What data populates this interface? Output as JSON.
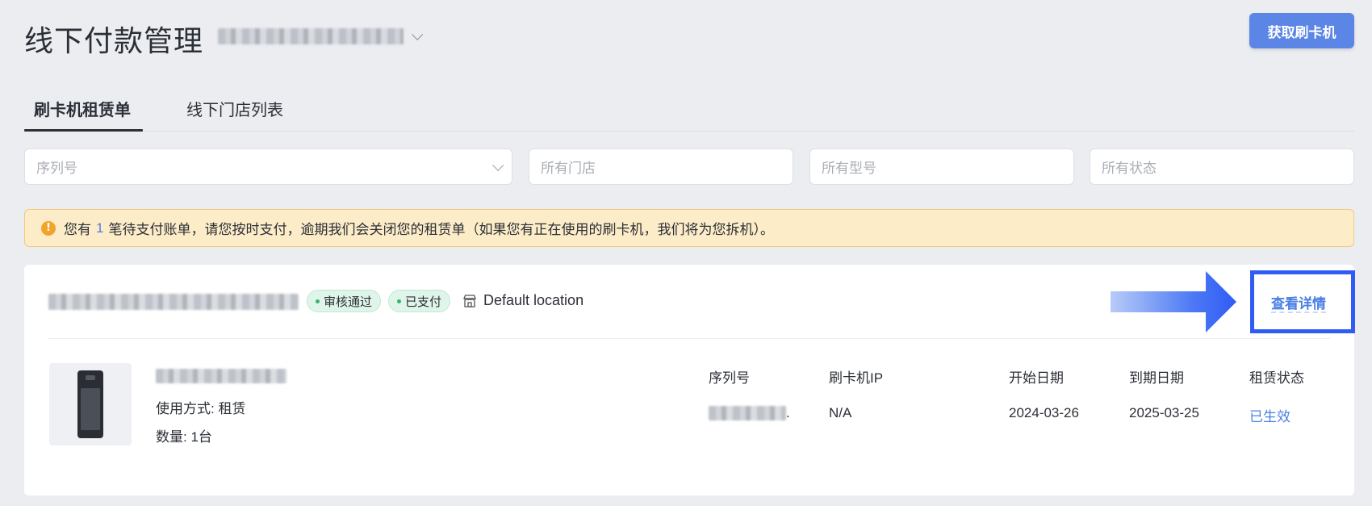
{
  "header": {
    "title": "线下付款管理",
    "get_terminal_button": "获取刷卡机"
  },
  "tabs": [
    {
      "label": "刷卡机租赁单",
      "active": true
    },
    {
      "label": "线下门店列表",
      "active": false
    }
  ],
  "filters": {
    "serial": "序列号",
    "store": "所有门店",
    "model": "所有型号",
    "status": "所有状态"
  },
  "alert": {
    "prefix": "您有",
    "count": "1",
    "message": "笔待支付账单，请您按时支付，逾期我们会关闭您的租赁单（如果您有正在使用的刷卡机，我们将为您拆机）。"
  },
  "order": {
    "badges": [
      "审核通过",
      "已支付"
    ],
    "location": "Default location",
    "detail_link": "查看详情",
    "usage": "使用方式: 租赁",
    "quantity": "数量: 1台",
    "columns": {
      "serial": "序列号",
      "ip": "刷卡机IP",
      "start": "开始日期",
      "end": "到期日期",
      "status": "租赁状态"
    },
    "values": {
      "serial_suffix": ".",
      "ip": "N/A",
      "start": "2024-03-26",
      "end": "2025-03-25",
      "status": "已生效"
    }
  },
  "colors": {
    "primary": "#5b86e5",
    "link": "#4a7fe3",
    "highlight_box": "#2f5cf5",
    "alert_bg": "#fdecc8",
    "badge_bg": "#e0f5ea"
  }
}
